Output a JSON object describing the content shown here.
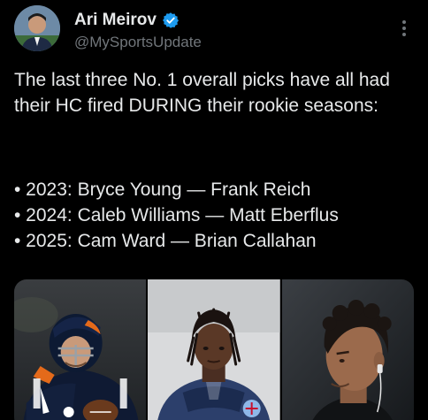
{
  "author": {
    "display_name": "Ari Meirov",
    "handle": "@MySportsUpdate",
    "verified": true
  },
  "tweet": {
    "text": "The last three No. 1 overall picks have all had their HC fired DURING their rookie seasons:",
    "bullets": [
      "• 2023: Bryce Young — Frank Reich",
      "• 2024: Caleb Williams — Matt Eberflus",
      "• 2025: Cam Ward — Brian Callahan"
    ]
  },
  "media": {
    "photos": [
      {
        "subject": "football-player-photo"
      },
      {
        "subject": "football-player-photo"
      },
      {
        "subject": "football-player-photo"
      }
    ]
  },
  "colors": {
    "background": "#000000",
    "text": "#e7e9ea",
    "secondary_text": "#71767b",
    "verified": "#1d9bf0"
  }
}
